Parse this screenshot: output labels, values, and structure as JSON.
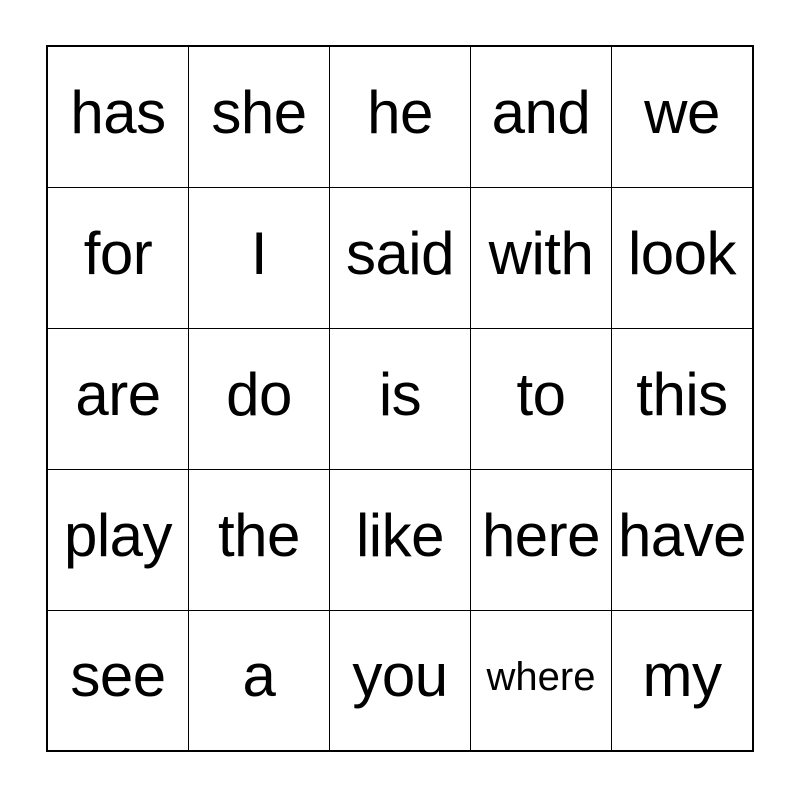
{
  "card": {
    "type": "bingo-card",
    "columns": 5,
    "rows": 5,
    "text_color": "#000000",
    "background_color": "#ffffff",
    "border_color": "#000000",
    "grid": [
      [
        {
          "word": "has",
          "shrink": false
        },
        {
          "word": "she",
          "shrink": false
        },
        {
          "word": "he",
          "shrink": false
        },
        {
          "word": "and",
          "shrink": false
        },
        {
          "word": "we",
          "shrink": false
        }
      ],
      [
        {
          "word": "for",
          "shrink": false
        },
        {
          "word": "I",
          "shrink": false
        },
        {
          "word": "said",
          "shrink": false
        },
        {
          "word": "with",
          "shrink": false
        },
        {
          "word": "look",
          "shrink": false
        }
      ],
      [
        {
          "word": "are",
          "shrink": false
        },
        {
          "word": "do",
          "shrink": false
        },
        {
          "word": "is",
          "shrink": false
        },
        {
          "word": "to",
          "shrink": false
        },
        {
          "word": "this",
          "shrink": false
        }
      ],
      [
        {
          "word": "play",
          "shrink": false
        },
        {
          "word": "the",
          "shrink": false
        },
        {
          "word": "like",
          "shrink": false
        },
        {
          "word": "here",
          "shrink": false
        },
        {
          "word": "have",
          "shrink": false
        }
      ],
      [
        {
          "word": "see",
          "shrink": false
        },
        {
          "word": "a",
          "shrink": false
        },
        {
          "word": "you",
          "shrink": false
        },
        {
          "word": "where",
          "shrink": true
        },
        {
          "word": "my",
          "shrink": false
        }
      ]
    ]
  }
}
